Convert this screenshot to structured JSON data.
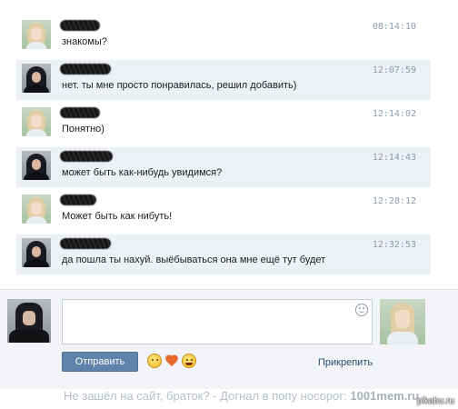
{
  "messages": [
    {
      "sender": "girl",
      "text": "знакомы?",
      "time": "08:14:10",
      "highlighted": false
    },
    {
      "sender": "guy",
      "text": "нет. ты мне просто понравилась, решил добавить)",
      "time": "12:07:59",
      "highlighted": true
    },
    {
      "sender": "girl",
      "text": "Понятно)",
      "time": "12:14:02",
      "highlighted": false
    },
    {
      "sender": "guy",
      "text": "может быть как-нибудь увидимся?",
      "time": "12:14:43",
      "highlighted": true
    },
    {
      "sender": "girl",
      "text": "Может быть как нибуть!",
      "time": "12:28:12",
      "highlighted": false
    },
    {
      "sender": "guy",
      "text": "да пошла ты нахуй. выёбываться она мне ещё тут будет",
      "time": "12:32:53",
      "highlighted": true
    }
  ],
  "composer": {
    "input_value": "",
    "send_label": "Отправить",
    "attach_label": "Прикрепить",
    "emoji_icons": [
      "happy-face-icon",
      "heart-icon",
      "grin-face-icon"
    ]
  },
  "watermark": {
    "text": "Не зашёл на сайт, браток? - Догнал в попу носорог:",
    "brand": "1001mem.ru"
  },
  "corner_watermark": "pikabu.ru",
  "colors": {
    "highlight_row": "#edf1f5",
    "send_button": "#5f83aa",
    "timestamp": "#8a9bb0"
  }
}
